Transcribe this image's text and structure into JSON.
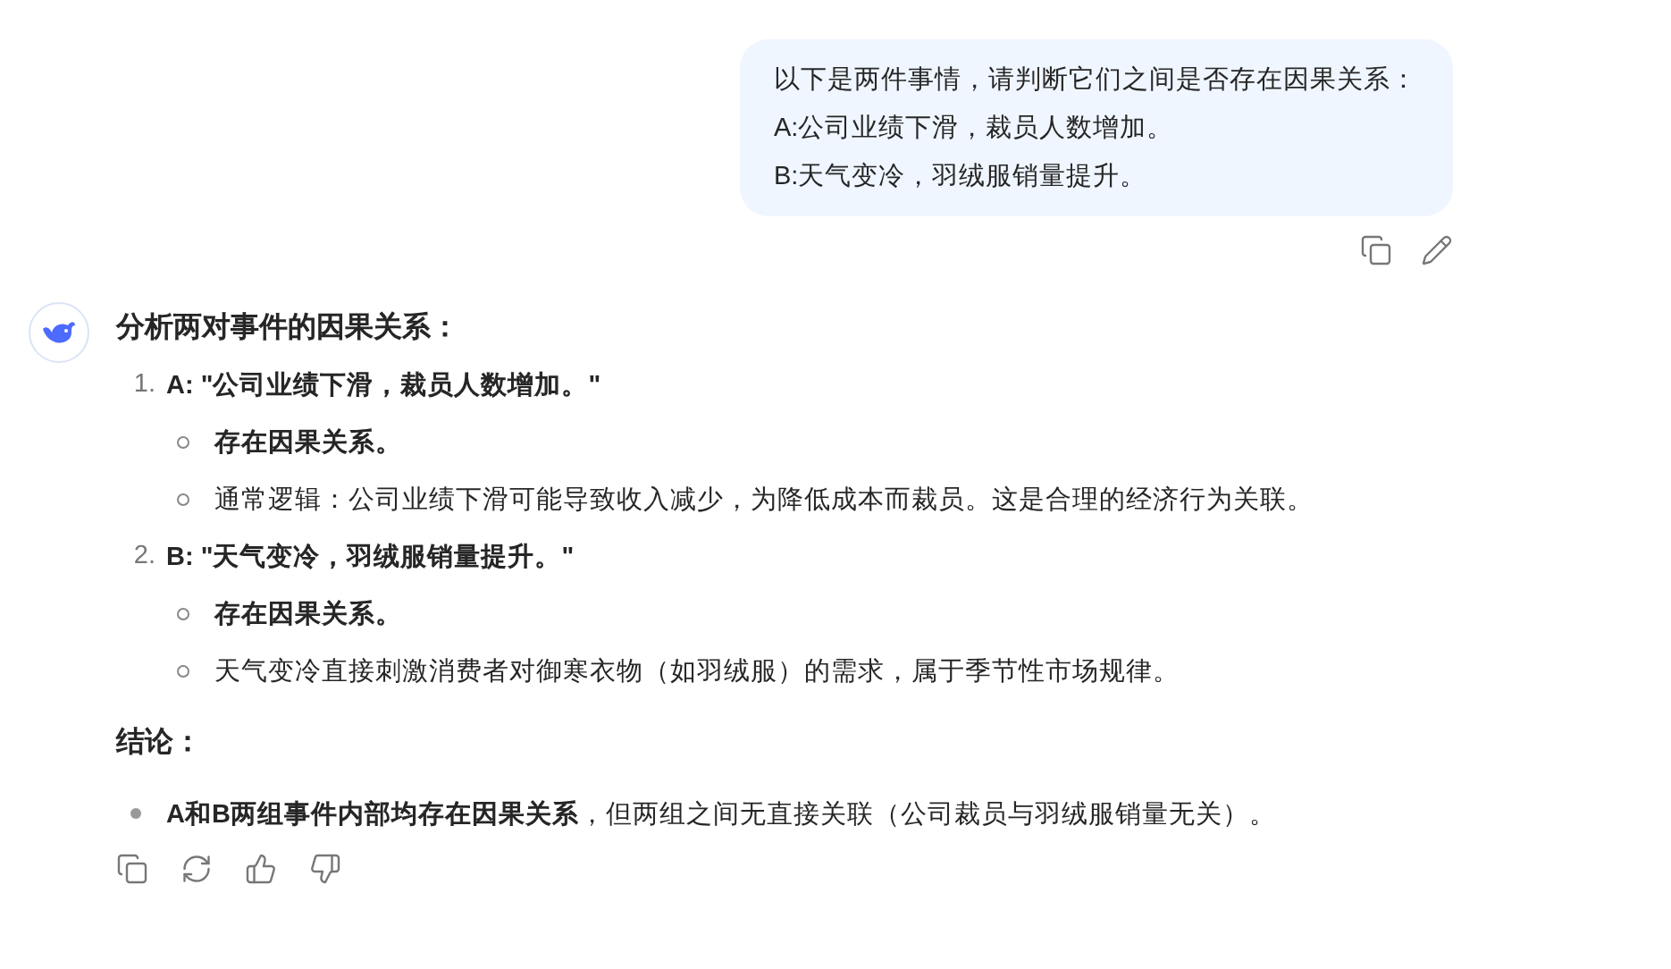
{
  "user_message": {
    "lines": [
      "以下是两件事情，请判断它们之间是否存在因果关系：",
      "A:公司业绩下滑，裁员人数增加。",
      "B:天气变冷，羽绒服销量提升。"
    ]
  },
  "reply": {
    "heading": "分析两对事件的因果关系：",
    "items": [
      {
        "number": "1.",
        "title": "A: \"公司业绩下滑，裁员人数增加。\"",
        "points": [
          {
            "text": "存在因果关系。",
            "bold": true
          },
          {
            "text": "通常逻辑：公司业绩下滑可能导致收入减少，为降低成本而裁员。这是合理的经济行为关联。",
            "bold": false
          }
        ]
      },
      {
        "number": "2.",
        "title": "B: \"天气变冷，羽绒服销量提升。\"",
        "points": [
          {
            "text": "存在因果关系。",
            "bold": true
          },
          {
            "text": "天气变冷直接刺激消费者对御寒衣物（如羽绒服）的需求，属于季节性市场规律。",
            "bold": false
          }
        ]
      }
    ],
    "conclusion_heading": "结论：",
    "conclusion": [
      "**A和B两组事件内部均存在因果关系**，但两组之间无直接关联（公司裁员与羽绒服销量无关）。"
    ]
  }
}
